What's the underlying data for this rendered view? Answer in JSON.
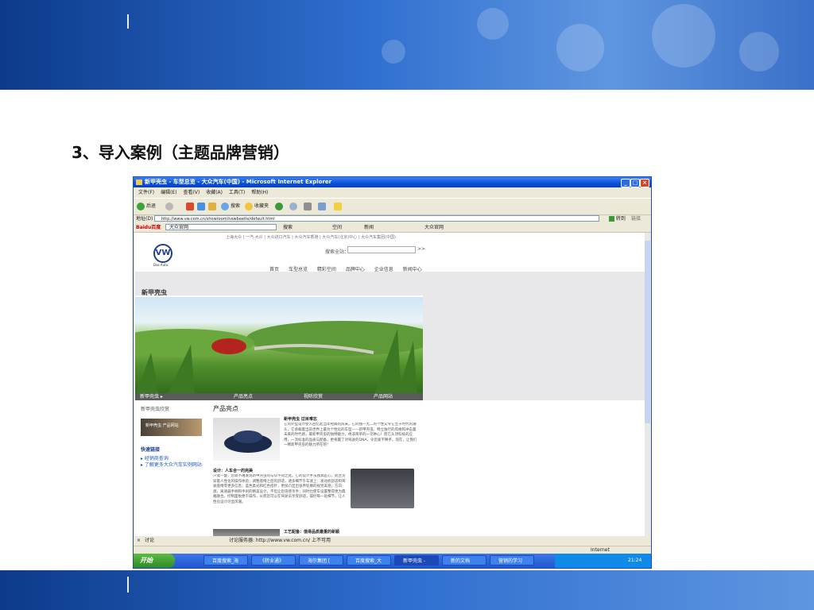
{
  "slide": {
    "title": "3、导入案例（主题品牌营销）"
  },
  "window": {
    "title": "新甲壳虫 - 车型总览 - 大众汽车(中国) - Microsoft Internet Explorer",
    "menu": [
      "文件(F)",
      "编辑(E)",
      "查看(V)",
      "收藏(A)",
      "工具(T)",
      "帮助(H)"
    ],
    "toolbar": {
      "back": "后退",
      "search": "搜索",
      "favorites": "收藏夹"
    },
    "address": {
      "label": "地址(D)",
      "url": "http://www.vw.com.cn/showroom/newbeetle/default.html",
      "go": "转到",
      "links": "链接"
    },
    "linksbar": {
      "logo": "Baidu百度",
      "site": "大众官网",
      "search": "搜索",
      "space": "空间",
      "news": "新闻",
      "home": "大众官网"
    },
    "findbar": {
      "close": "×",
      "label": "讨论",
      "text": "讨论服务器: http://www.vw.com.cn/ 上不可用"
    },
    "status": {
      "zone": "Internet"
    },
    "taskbar": {
      "start": "开始",
      "tasks": [
        "百度搜索_海",
        "《转业通》",
        "海尔集团 [",
        "百度搜索_大",
        "新甲壳虫 -",
        "新的文档",
        "营销的学习"
      ],
      "time": "21:24"
    }
  },
  "page": {
    "toplinks": "上海大众 | 一汽-大众 | 大众进口汽车 | 大众汽车香港 | 大众汽车(北京)中心 | 大众汽车集团(中国)",
    "brand": "VW",
    "brand_name": "Das Auto.",
    "search_label": "搜索全站：",
    "search_btn": ">>",
    "nav": [
      "首页",
      "车型总览",
      "精彩空间",
      "品牌中心",
      "企业信息",
      "新闻中心"
    ],
    "model_title": "新甲壳虫",
    "subnav": [
      "新甲壳虫 ▸",
      "产品亮点",
      "视听欣赏",
      "产品网站"
    ],
    "side_head": "新甲壳虫欣赏",
    "side_promo": "新甲壳虫 产品网站",
    "quick_title": "快速链接",
    "quick_links": [
      "▸ 经销商查询",
      "▸ 了解更多大众汽车实例网站"
    ],
    "section_title": "产品亮点",
    "block1": {
      "title": "新甲壳虫 过目难忘",
      "text": "它的外型设计使人回忆起当年经典的风采，它的独一无二的个性又令它立于时代的潮头，它承载着当前世界上最为个性化的车型——新甲壳虫。特立独行的风格和冲击着未来的时代感，最新甲壳虫的独特魅力，绝非简单的一见钟心！而它头顶科技的应用，一流标准的品质与配备，更将赢了对驾驶的DNA，令您爱不释手。现在，让我们一睹新甲壳虫的魅力所在吧！"
    },
    "block2": {
      "title": "设计：人车合一的完美",
      "text": "只需一瞥，您就不难发现新甲壳虫的与众不同之处。它的设计手法独具匠心，而且贯穿着人性化的操作体验；调整座椅之后的舒适，诸多细节于车速上：发动机舒适和驾驶座椅等更多信息；蓝色类光和红色指针，更加凸显出张界轮廓的视觉美感；方向盘、离速器手柄和手刹的精美设计，不但让您倍感亲手；同时也使车设置整得更为典雅融合。控制面板便于操作，从而您可以在驾驶员享受舒适，操控每一处细节，让人性化设计尽显风潮。"
    },
    "block3": {
      "title": "工艺配备：值得品质最重的新颖"
    }
  },
  "colors": {
    "xp_blue": "#0a4fd8",
    "start_green": "#3a9a2c",
    "banner_blue": "#2f6fd0",
    "vw_blue": "#1f3f8a"
  }
}
